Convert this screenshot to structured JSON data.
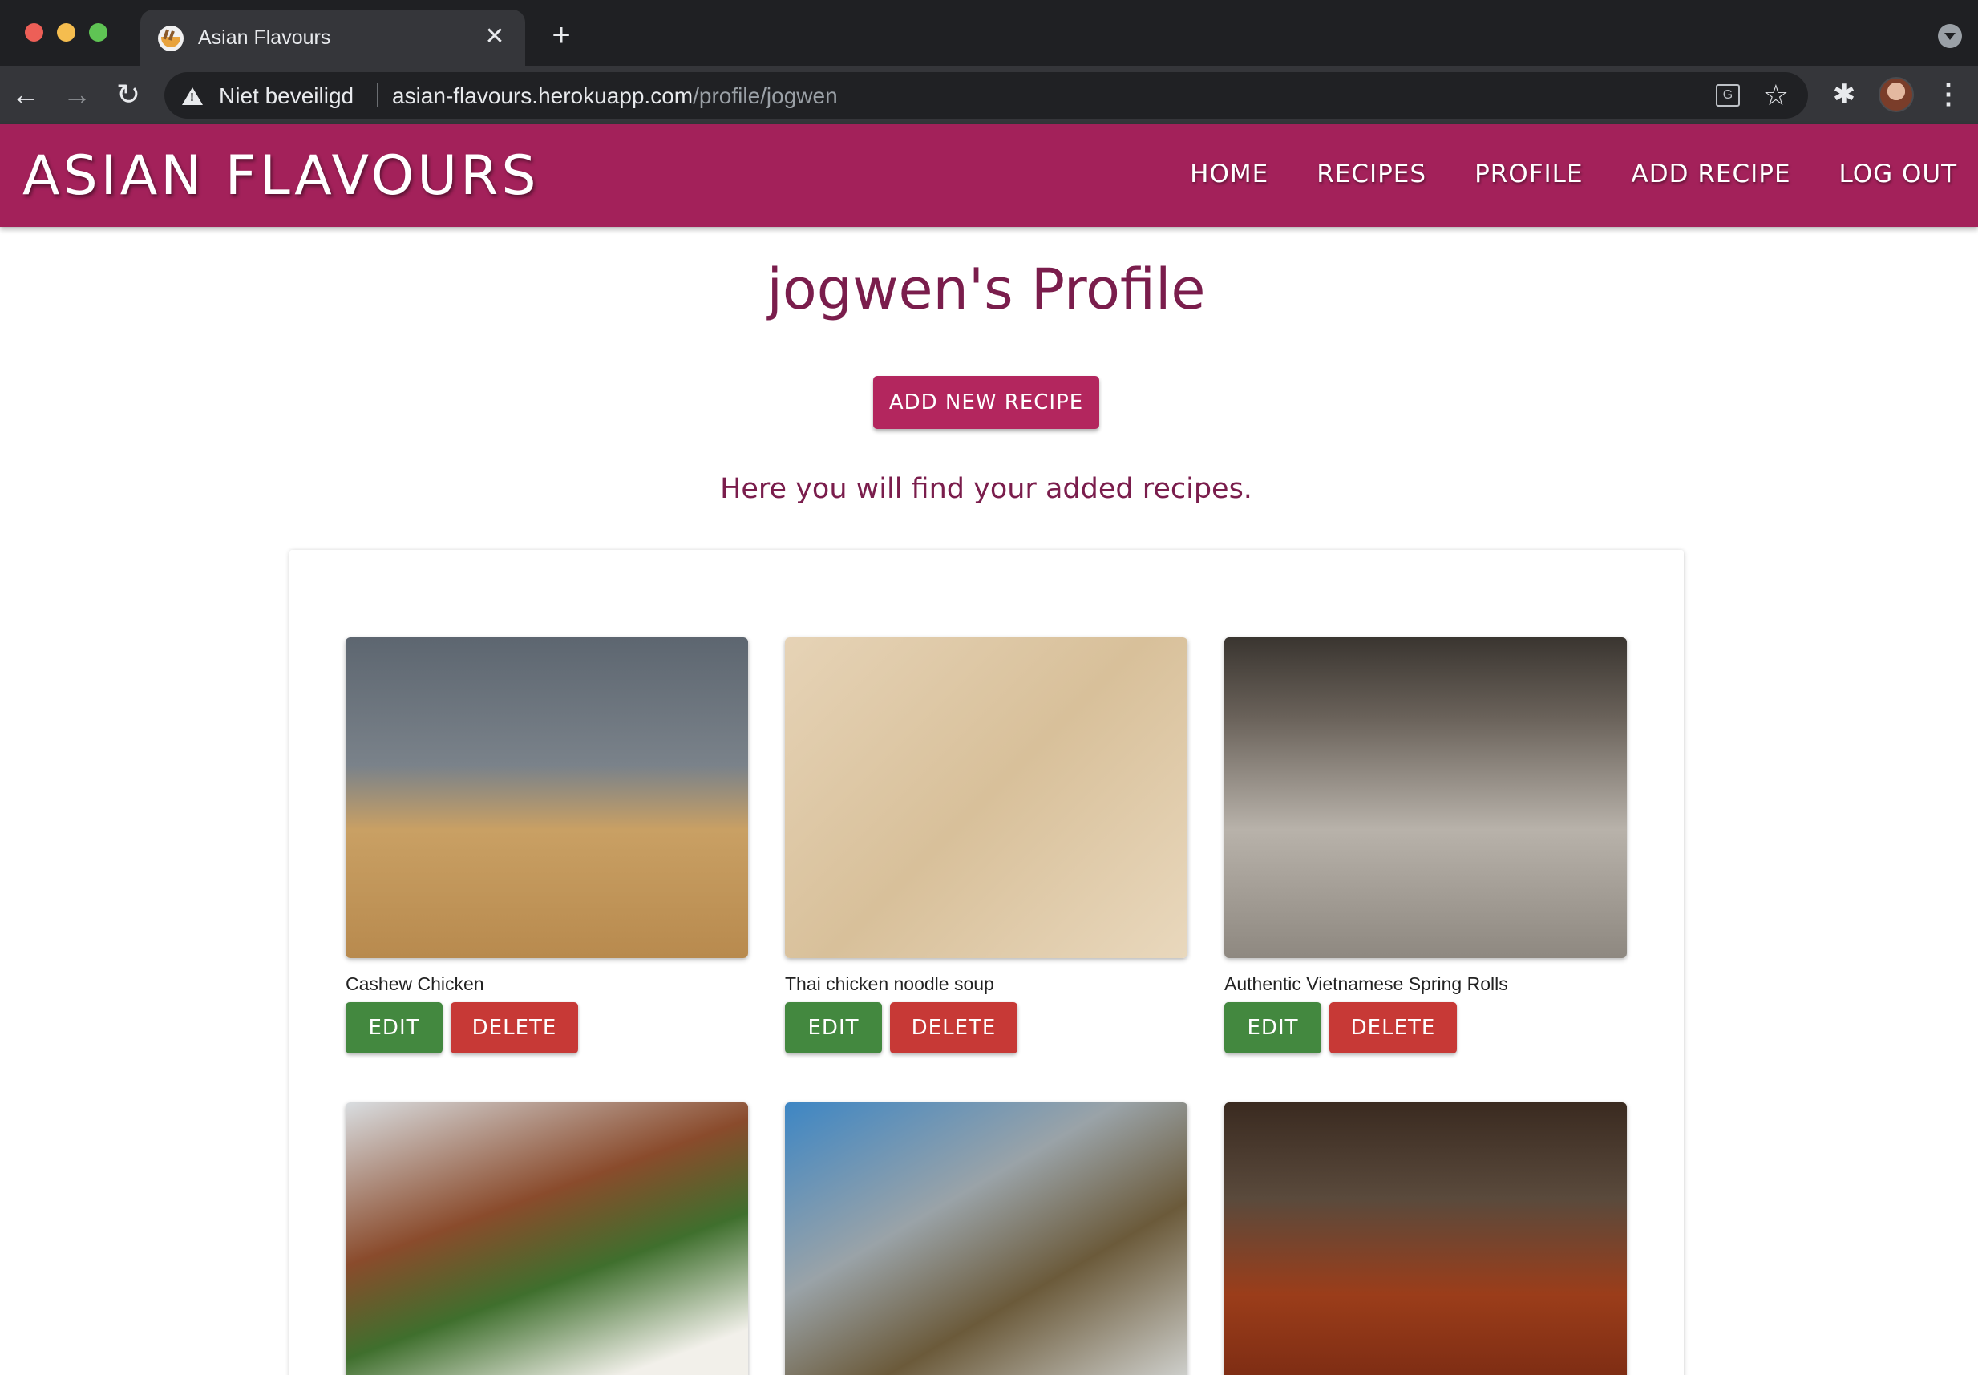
{
  "browser": {
    "tab_title": "Asian Flavours",
    "tab_close": "✕",
    "new_tab": "+",
    "back": "←",
    "forward": "→",
    "reload": "↻",
    "security_label": "Niet beveiligd",
    "url_host": "asian-flavours.herokuapp.com",
    "url_path": "/profile/jogwen",
    "icons": [
      "back-arrow-icon",
      "forward-arrow-icon",
      "reload-icon",
      "warning-icon",
      "translate-icon",
      "star-icon",
      "extensions-icon",
      "menu-dots-icon"
    ]
  },
  "site": {
    "brand": "ASIAN FLAVOURS",
    "nav": [
      "HOME",
      "RECIPES",
      "PROFILE",
      "ADD RECIPE",
      "LOG OUT"
    ],
    "accent_color": "#a3215a"
  },
  "main": {
    "title": "jogwen's Profile",
    "add_button": "ADD NEW RECIPE",
    "intro": "Here you will find your added recipes."
  },
  "recipes": [
    {
      "name": "Cashew Chicken",
      "edit": "EDIT",
      "delete": "DELETE"
    },
    {
      "name": "Thai chicken noodle soup",
      "edit": "EDIT",
      "delete": "DELETE"
    },
    {
      "name": "Authentic Vietnamese Spring Rolls",
      "edit": "EDIT",
      "delete": "DELETE"
    },
    {
      "name": "",
      "edit": "",
      "delete": ""
    },
    {
      "name": "",
      "edit": "",
      "delete": ""
    },
    {
      "name": "",
      "edit": "",
      "delete": ""
    }
  ],
  "colors": {
    "edit_button": "#43883f",
    "delete_button": "#c73936",
    "title_text": "#7a1d4c"
  }
}
